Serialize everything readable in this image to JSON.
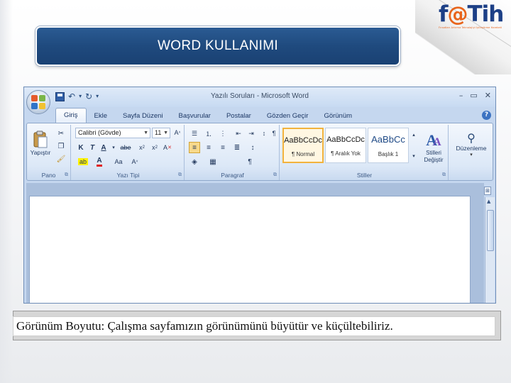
{
  "slide": {
    "title": "WORD KULLANIMI",
    "caption": "Görünüm Boyutu: Çalışma sayfamızın görünümünü büyütür ve küçültebiliriz."
  },
  "logo": {
    "brand_f": "f",
    "brand_at": "@",
    "brand_t": "T",
    "brand_ih": "ih",
    "tagline": "Fırsatları Artırma Teknolojiyi İyileştirme Hareketi",
    "colors": {
      "blue": "#1c3f86",
      "orange": "#e8641b"
    }
  },
  "word": {
    "window_title": "Yazılı Soruları - Microsoft Word",
    "tabs": [
      "Giriş",
      "Ekle",
      "Sayfa Düzeni",
      "Başvurular",
      "Postalar",
      "Gözden Geçir",
      "Görünüm"
    ],
    "active_tab": "Giriş",
    "groups": {
      "clipboard": {
        "label": "Pano",
        "paste_label": "Yapıştır"
      },
      "font": {
        "label": "Yazı Tipi",
        "font_name": "Calibri (Gövde)",
        "font_size": "11"
      },
      "paragraph": {
        "label": "Paragraf"
      },
      "styles": {
        "label": "Stiller",
        "items": [
          {
            "sample": "AaBbCcDc",
            "name": "¶ Normal"
          },
          {
            "sample": "AaBbCcDc",
            "name": "¶ Aralık Yok"
          },
          {
            "sample": "AaBbCc",
            "name": "Başlık 1"
          }
        ],
        "change_styles_label": "Stilleri Değiştir"
      },
      "editing": {
        "label": "Düzenleme"
      }
    }
  },
  "colors": {
    "banner": "#1f4a7e",
    "ribbon": "#dce8f7",
    "window_frame": "#c5d7ef"
  }
}
